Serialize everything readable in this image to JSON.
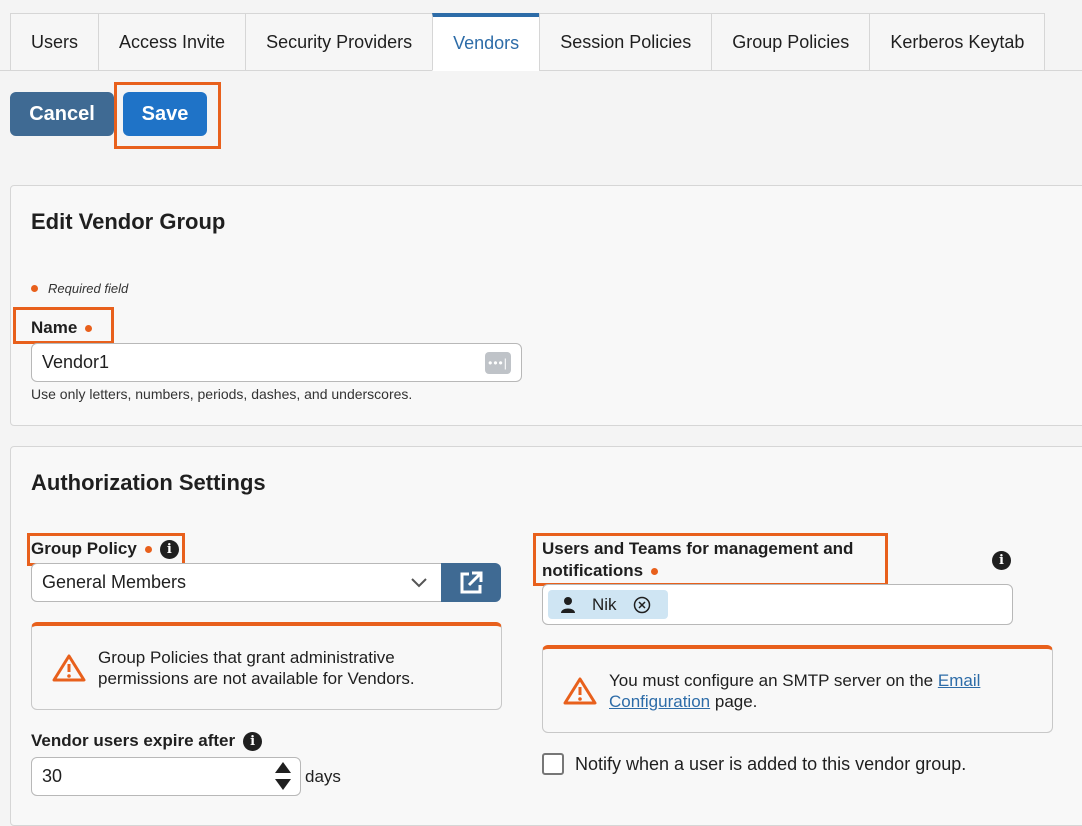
{
  "tabs": [
    {
      "label": "Users",
      "active": false
    },
    {
      "label": "Access Invite",
      "active": false
    },
    {
      "label": "Security Providers",
      "active": false
    },
    {
      "label": "Vendors",
      "active": true
    },
    {
      "label": "Session Policies",
      "active": false
    },
    {
      "label": "Group Policies",
      "active": false
    },
    {
      "label": "Kerberos Keytab",
      "active": false
    }
  ],
  "toolbar": {
    "cancel_label": "Cancel",
    "save_label": "Save"
  },
  "edit_panel": {
    "title": "Edit Vendor Group",
    "required_note": "Required field",
    "name_label": "Name",
    "name_value": "Vendor1",
    "name_hint": "Use only letters, numbers, periods, dashes, and underscores."
  },
  "auth_panel": {
    "title": "Authorization Settings",
    "group_policy_label": "Group Policy",
    "group_policy_value": "General Members",
    "group_policy_warning": "Group Policies that grant administrative permissions are not available for Vendors.",
    "users_teams_label_line1": "Users and Teams for management and",
    "users_teams_label_line2": "notifications",
    "user_chip": "Nik",
    "smtp_warning_pre": "You must configure an SMTP server on the",
    "smtp_warning_link_1": "Email",
    "smtp_warning_link_2": "Configuration",
    "smtp_warning_post": "page.",
    "expire_label": "Vendor users expire after",
    "expire_value": "30",
    "expire_unit": "days",
    "notify_label": "Notify when a user is added to this vendor group."
  },
  "colors": {
    "accent": "#2d6ca8",
    "highlight": "#e8601c",
    "warning": "#e8601c"
  }
}
